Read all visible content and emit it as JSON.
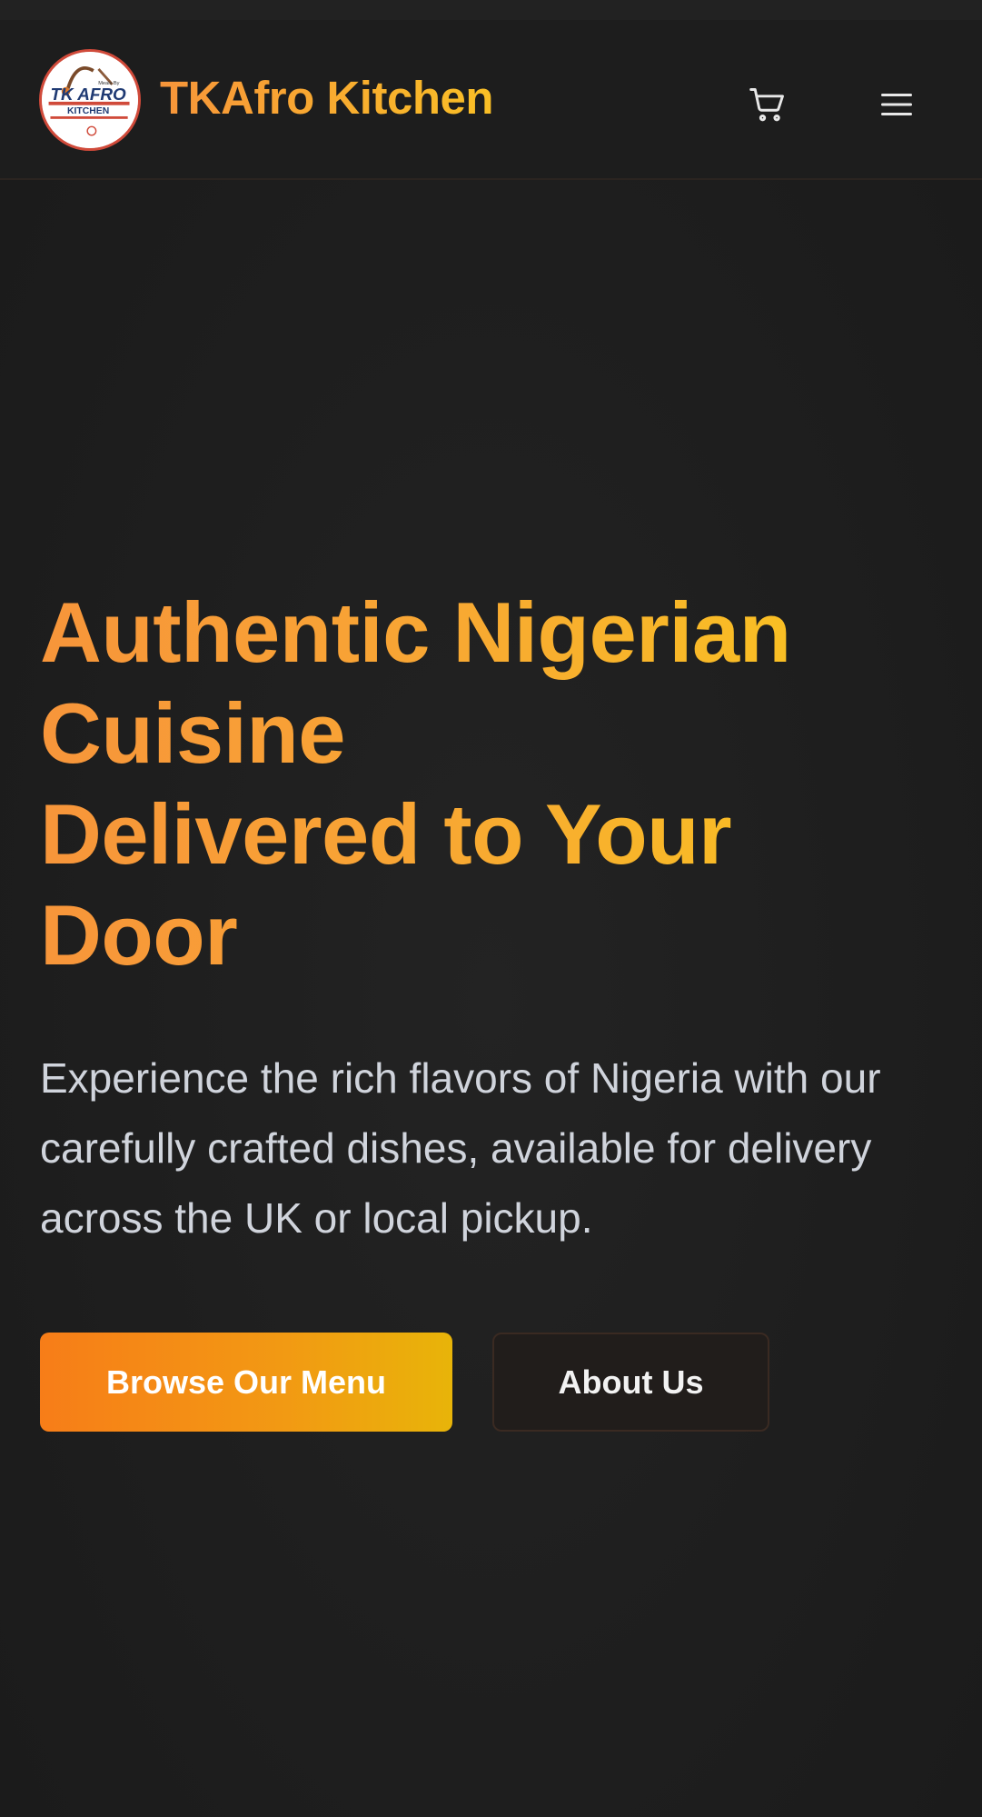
{
  "header": {
    "brand_name": "TKAfro Kitchen",
    "logo_text_line1": "TK AFRO",
    "logo_text_line2": "KITCHEN",
    "logo_small_text": "Meals By",
    "cart_icon": "cart-icon",
    "menu_icon": "hamburger-menu-icon"
  },
  "hero": {
    "title_lines": [
      "Authentic Nigerian",
      "Cuisine",
      "Delivered to Your",
      "Door"
    ],
    "subtitle": "Experience the rich flavors of Nigeria with our carefully crafted dishes, available for delivery across the UK or local pickup.",
    "primary_button": "Browse Our Menu",
    "secondary_button": "About Us"
  },
  "colors": {
    "background": "#1c1c1c",
    "brand_gradient_start": "#f7953a",
    "brand_gradient_end": "#f9c321",
    "button_gradient_start": "#f77d18",
    "button_gradient_end": "#e8b409"
  }
}
